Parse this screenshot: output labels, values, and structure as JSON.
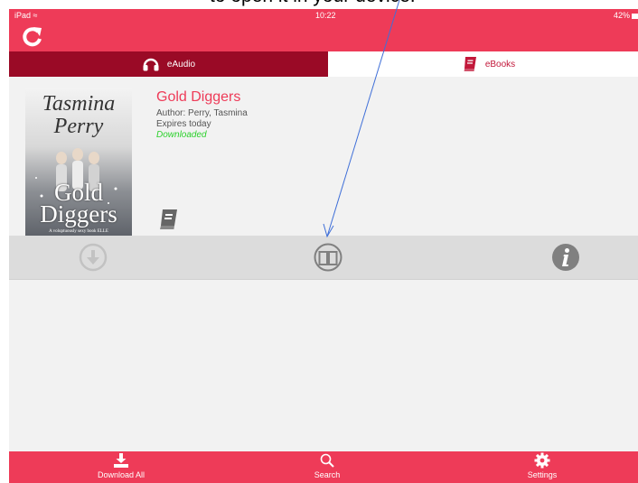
{
  "caption": "to open it in your device.",
  "status_bar": {
    "device": "iPad",
    "time": "10:22",
    "battery": "42%"
  },
  "tabs": [
    {
      "label": "eAudio",
      "active": true
    },
    {
      "label": "eBooks",
      "active": false
    }
  ],
  "book": {
    "title": "Gold Diggers",
    "author": "Author: Perry, Tasmina",
    "expiry": "Expires today",
    "status": "Downloaded",
    "cover": {
      "author": "Tasmina Perry",
      "title": "Gold Diggers",
      "tagline": "A voluptuously sexy book  ELLE"
    }
  },
  "actions": [
    "download-icon",
    "open-book-icon",
    "info-icon"
  ],
  "bottom_tabs": [
    {
      "label": "Download All",
      "icon": "download-all-icon"
    },
    {
      "label": "Search",
      "icon": "search-icon"
    },
    {
      "label": "Settings",
      "icon": "gear-icon"
    }
  ],
  "colors": {
    "accent": "#ee3b58",
    "tab_active": "#9a0a26",
    "downloaded": "#2ad12a",
    "action_bar": "#dcdcdc"
  }
}
